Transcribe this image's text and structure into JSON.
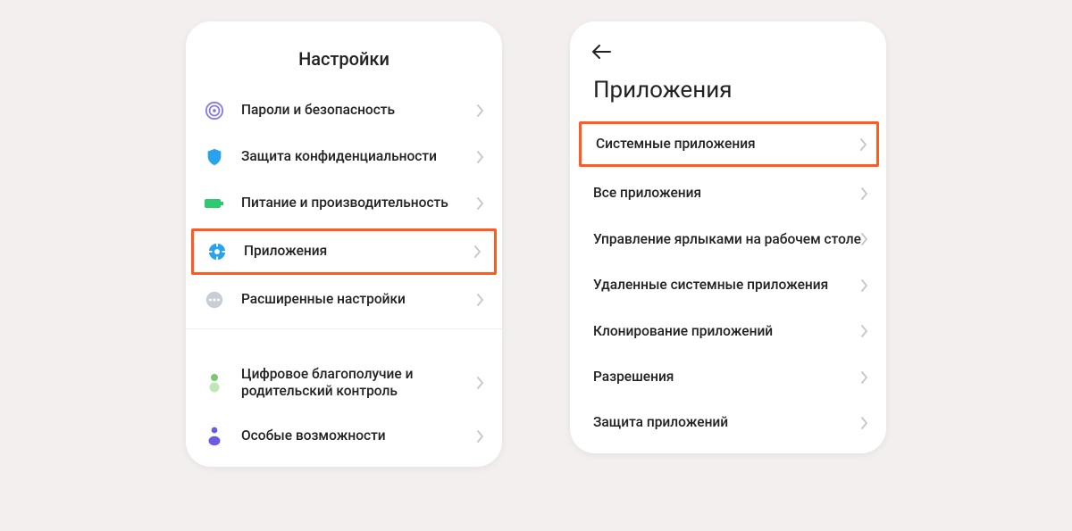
{
  "colors": {
    "highlight": "#ff5a1f"
  },
  "left": {
    "title": "Настройки",
    "items": [
      {
        "icon": "fingerprint-icon",
        "label": "Пароли и безопасность",
        "highlighted": false
      },
      {
        "icon": "shield-icon",
        "label": "Защита конфиденциальности",
        "highlighted": false
      },
      {
        "icon": "battery-icon",
        "label": "Питание и производительность",
        "highlighted": false
      },
      {
        "icon": "gear-icon",
        "label": "Приложения",
        "highlighted": true
      },
      {
        "icon": "dots-icon",
        "label": "Расширенные настройки",
        "highlighted": false
      }
    ],
    "items2": [
      {
        "icon": "wellbeing-icon",
        "label": "Цифровое благополучие и родительский контроль"
      },
      {
        "icon": "accessibility-icon",
        "label": "Особые возможности"
      }
    ]
  },
  "right": {
    "title": "Приложения",
    "items": [
      {
        "label": "Системные приложения",
        "highlighted": true
      },
      {
        "label": "Все приложения",
        "highlighted": false
      },
      {
        "label": "Управление ярлыками на рабочем столе",
        "highlighted": false
      },
      {
        "label": "Удаленные системные приложения",
        "highlighted": false
      },
      {
        "label": "Клонирование приложений",
        "highlighted": false
      },
      {
        "label": "Разрешения",
        "highlighted": false
      },
      {
        "label": "Защита приложений",
        "highlighted": false
      }
    ]
  }
}
